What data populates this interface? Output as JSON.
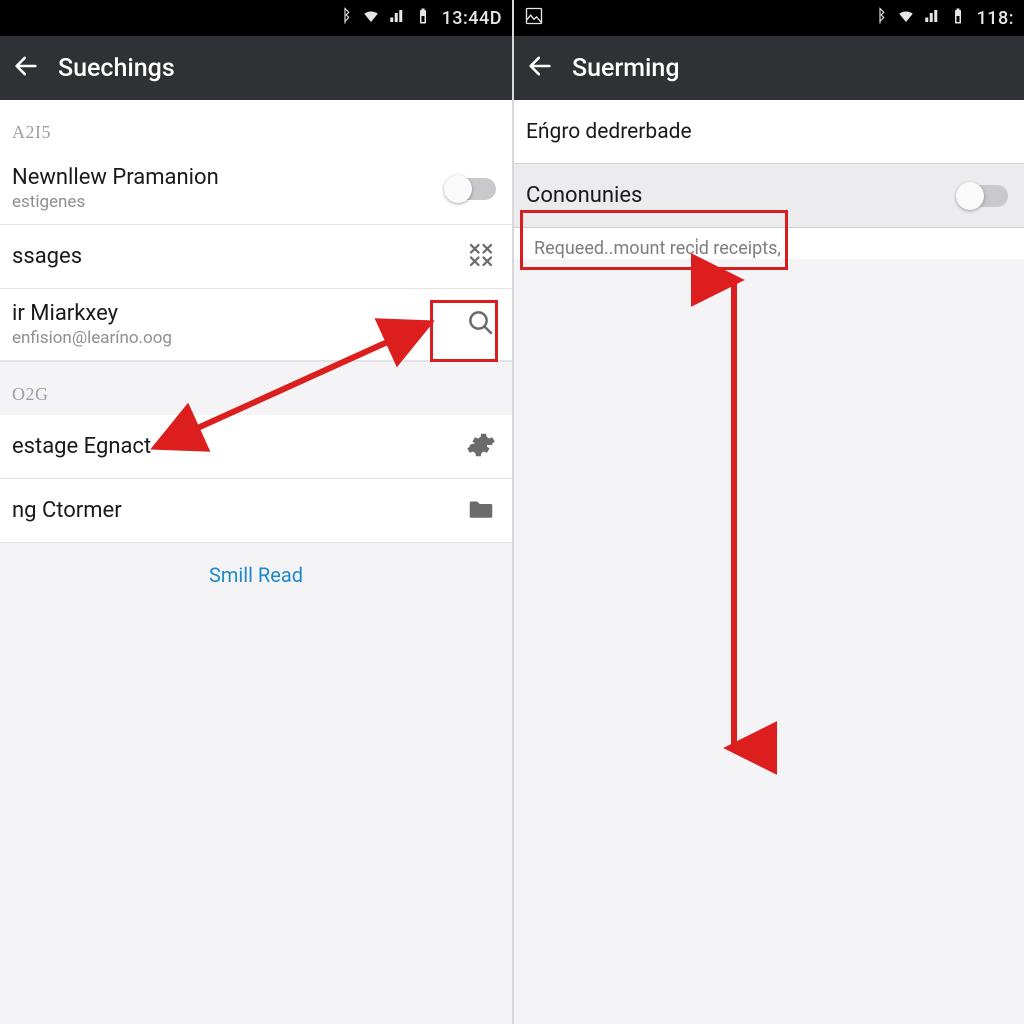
{
  "left": {
    "status_time": "13:44D",
    "title": "Suechings",
    "section1": "A2I5",
    "row1": {
      "primary": "Newnllew Pramanion",
      "secondary": "estigenes"
    },
    "row2": {
      "primary": "ssages"
    },
    "row3": {
      "primary": "ir Miarkxey",
      "secondary": "enfision@learíno.oog"
    },
    "section2": "O2G",
    "row4": {
      "primary": "estage Egnact"
    },
    "row5": {
      "primary": "ng Ctormer"
    },
    "link": "Smill Read"
  },
  "right": {
    "status_time": "118:",
    "title": "Suerming",
    "header_label": "Eńgro dedrerbade",
    "row1": {
      "primary": "Cononunies"
    },
    "note": "Requeed..mount reci̇d receipts,"
  }
}
